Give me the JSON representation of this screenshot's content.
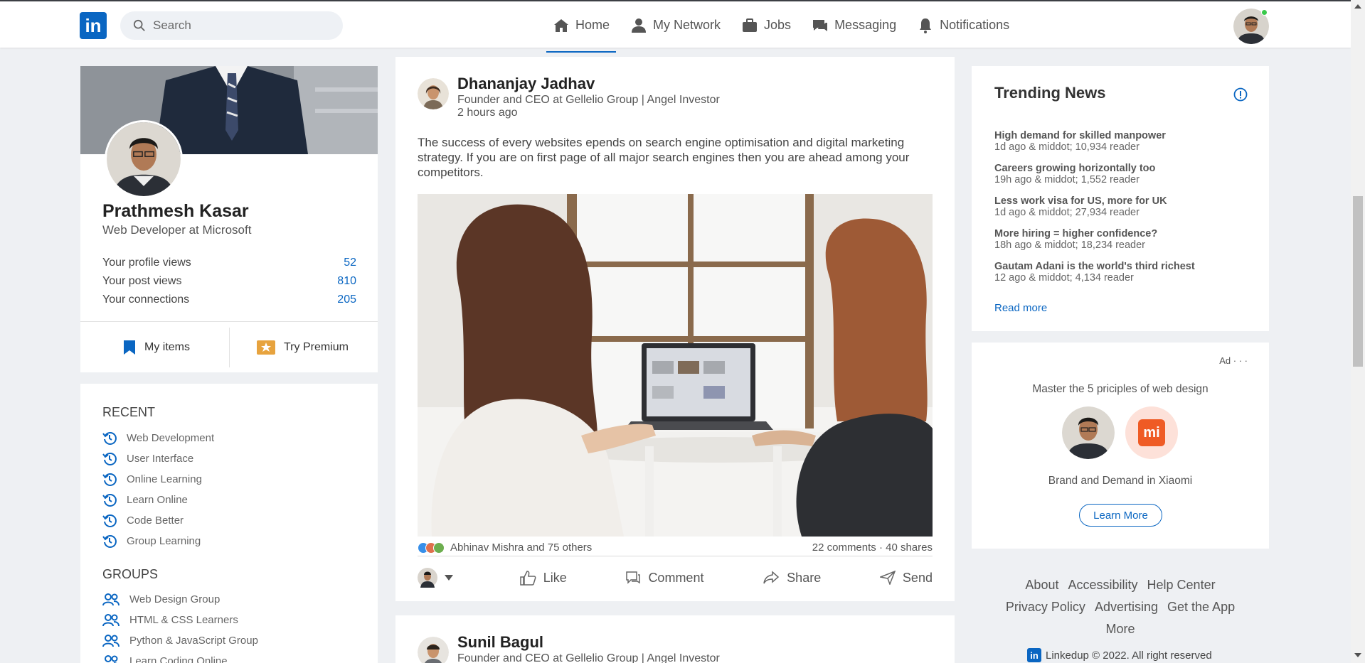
{
  "colors": {
    "brand": "#0a66c2",
    "online": "#3ac94b",
    "xiaomi": "#ef5b25"
  },
  "navbar": {
    "logo_text": "in",
    "search_placeholder": "Search",
    "items": [
      {
        "label": "Home",
        "icon": "home-icon",
        "active": true
      },
      {
        "label": "My Network",
        "icon": "network-icon"
      },
      {
        "label": "Jobs",
        "icon": "briefcase-icon"
      },
      {
        "label": "Messaging",
        "icon": "messaging-icon"
      },
      {
        "label": "Notifications",
        "icon": "bell-icon"
      }
    ]
  },
  "profile": {
    "name": "Prathmesh Kasar",
    "title": "Web Developer at Microsoft",
    "stats": [
      {
        "label": "Your profile views",
        "value": "52"
      },
      {
        "label": "Your post views",
        "value": "810"
      },
      {
        "label": "Your connections",
        "value": "205"
      }
    ],
    "my_items": "My items",
    "try_premium": "Try Premium"
  },
  "recent": {
    "heading": "RECENT",
    "items": [
      "Web Development",
      "User Interface",
      "Online Learning",
      "Learn Online",
      "Code Better",
      "Group Learning"
    ]
  },
  "groups": {
    "heading": "GROUPS",
    "items": [
      "Web Design Group",
      "HTML & CSS Learners",
      "Python & JavaScript Group",
      "Learn Coding Online"
    ]
  },
  "post": {
    "author": "Dhananjay Jadhav",
    "subtitle": "Founder and CEO at Gellelio Group | Angel Investor",
    "time": "2 hours ago",
    "text": "The success of every websites epends on search engine optimisation and digital marketing strategy. If you are on first page of all major search engines then you are ahead among your competitors.",
    "reactions_text": "Abhinav Mishra and 75 others",
    "stats_text": "22 comments · 40 shares",
    "actions": {
      "like": "Like",
      "comment": "Comment",
      "share": "Share",
      "send": "Send"
    }
  },
  "post2": {
    "author": "Sunil Bagul",
    "subtitle": "Founder and CEO at Gellelio Group | Angel Investor"
  },
  "trending": {
    "title": "Trending News",
    "items": [
      {
        "headline": "High demand for skilled manpower",
        "meta": "1d ago & middot; 10,934 reader"
      },
      {
        "headline": "Careers growing horizontally too",
        "meta": "19h ago & middot; 1,552 reader"
      },
      {
        "headline": "Less work visa for US, more for UK",
        "meta": "1d ago & middot; 27,934 reader"
      },
      {
        "headline": "More hiring = higher confidence?",
        "meta": "18h ago & middot; 18,234 reader"
      },
      {
        "headline": "Gautam Adani is the world's third richest",
        "meta": "12 ago & middot; 4,134 reader"
      }
    ],
    "read_more": "Read more"
  },
  "ad": {
    "label": "Ad · · ·",
    "headline": "Master the 5 priciples of web design",
    "brand_text": "Brand and Demand in Xiaomi",
    "logo_text": "mi",
    "cta": "Learn More"
  },
  "footer": {
    "links_row1": [
      "About",
      "Accessibility",
      "Help Center"
    ],
    "links_row2": [
      "Privacy Policy",
      "Advertising",
      "Get the App"
    ],
    "links_row3": [
      "More"
    ],
    "logo_text": "in",
    "copyright": "Linkedup © 2022. All right reserved"
  }
}
